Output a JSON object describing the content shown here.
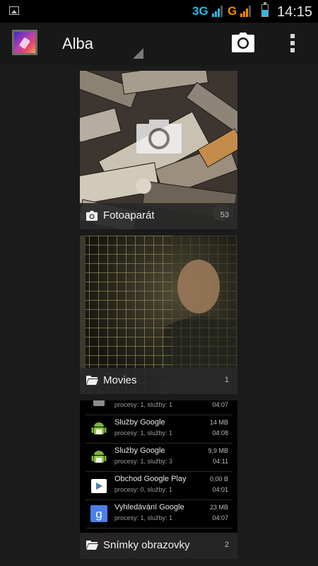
{
  "status_bar": {
    "network_1": "3G",
    "network_2": "G",
    "time": "14:15"
  },
  "action_bar": {
    "title": "Alba",
    "icons": [
      "gallery-app-icon",
      "camera-icon",
      "overflow-menu-icon"
    ]
  },
  "albums": [
    {
      "label": "Fotoaparát",
      "count": "53",
      "icon": "camera-icon"
    },
    {
      "label": "Movies",
      "count": "1",
      "icon": "folder-icon"
    },
    {
      "label": "Snímky obrazovky",
      "count": "2",
      "icon": "folder-icon"
    }
  ],
  "screenshot_list": [
    {
      "name": "",
      "sub": "procesy: 1, služby: 1",
      "size": "",
      "time": "04:07"
    },
    {
      "name": "Služby Google",
      "sub": "procesy: 1, služby: 1",
      "size": "14 MB",
      "time": "04:08"
    },
    {
      "name": "Služby Google",
      "sub": "procesy: 1, služby: 3",
      "size": "9,9 MB",
      "time": "04:11"
    },
    {
      "name": "Obchod Google Play",
      "sub": "procesy: 0, služby: 1",
      "size": "0,00 B",
      "time": "04:01"
    },
    {
      "name": "Vyhledávání Google",
      "sub": "procesy: 1, služby: 1",
      "size": "23 MB",
      "time": "04:07"
    }
  ],
  "colors": {
    "accent_blue": "#33b5e5",
    "accent_orange": "#ff8a00",
    "background": "#1b1b1b"
  }
}
